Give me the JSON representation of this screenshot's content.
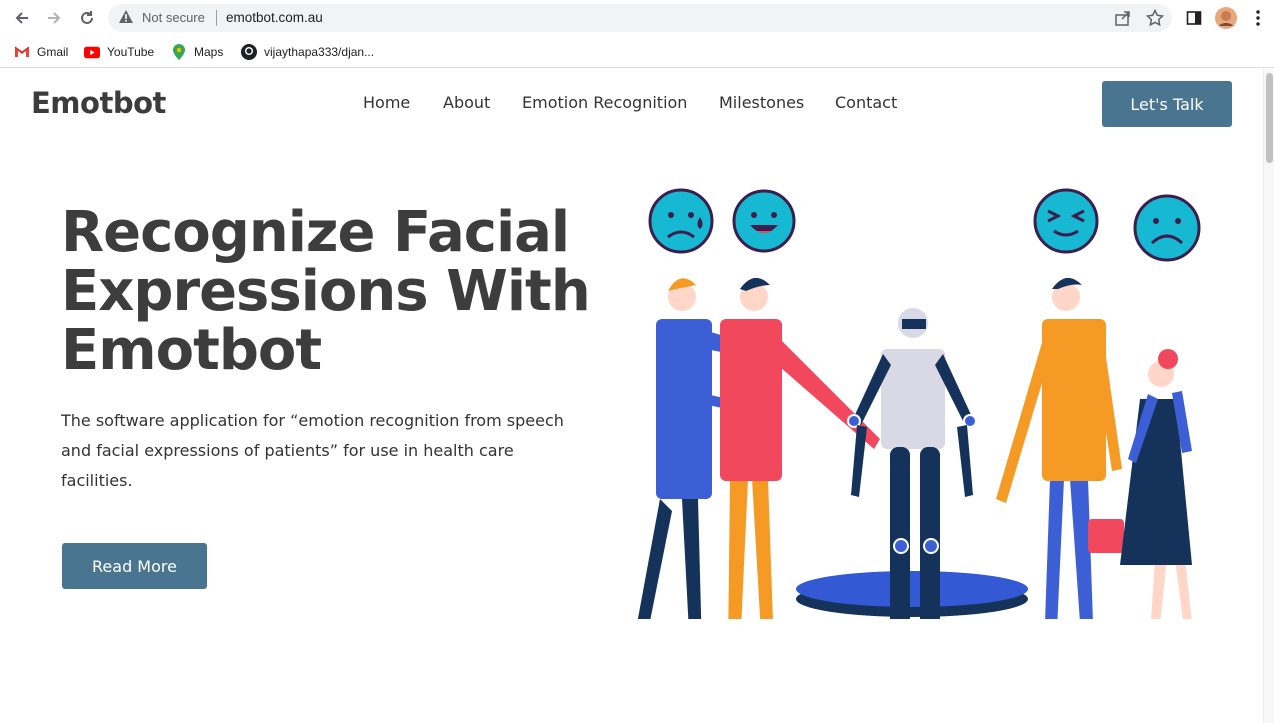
{
  "browser": {
    "security_label": "Not secure",
    "url": "emotbot.com.au",
    "bookmarks": [
      {
        "label": "Gmail",
        "icon": "gmail-icon"
      },
      {
        "label": "YouTube",
        "icon": "youtube-icon"
      },
      {
        "label": "Maps",
        "icon": "maps-icon"
      },
      {
        "label": "vijaythapa333/djan...",
        "icon": "github-icon"
      }
    ]
  },
  "site": {
    "logo": "Emotbot",
    "nav": [
      "Home",
      "About",
      "Emotion Recognition",
      "Milestones",
      "Contact"
    ],
    "cta": "Let's Talk"
  },
  "hero": {
    "title_line1": "Recognize Facial",
    "title_line2": "Expressions With",
    "title_line3": "Emotbot",
    "description": "The software application for “emotion recognition from speech and facial expressions of patients” for use in health care facilities.",
    "button": "Read More"
  },
  "colors": {
    "accent": "#4a7591",
    "heading": "#3d3d3d"
  }
}
